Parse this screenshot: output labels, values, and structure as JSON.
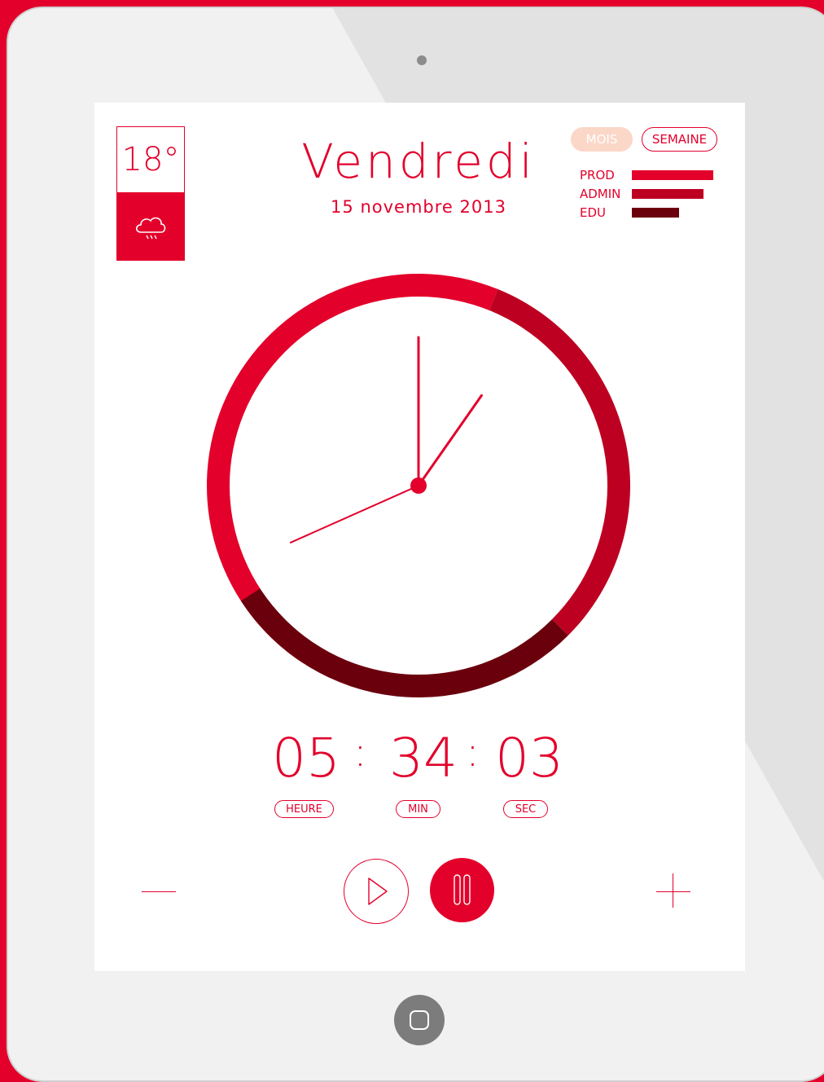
{
  "weather": {
    "temperature": "18°",
    "condition_icon": "rain-cloud-icon"
  },
  "header": {
    "day": "Vendredi",
    "date": "15 novembre 2013"
  },
  "view_toggle": {
    "month": "MOIS",
    "week": "SEMAINE",
    "active": "SEMAINE"
  },
  "legend": [
    {
      "label": "PROD",
      "value": 100,
      "color": "#e3002b"
    },
    {
      "label": "ADMIN",
      "value": 88,
      "color": "#bd0021"
    },
    {
      "label": "EDU",
      "value": 58,
      "color": "#6b000d"
    }
  ],
  "ring": {
    "segments": [
      {
        "name": "PROD",
        "from_deg": 213,
        "to_deg": 382,
        "color": "#e3002b"
      },
      {
        "name": "ADMIN",
        "from_deg": 22,
        "to_deg": 135,
        "color": "#bd0021"
      },
      {
        "name": "EDU",
        "from_deg": 135,
        "to_deg": 237,
        "color": "#6b000d"
      }
    ]
  },
  "clock_hands": {
    "hour": 1,
    "minute": 0,
    "second": 40
  },
  "timer": {
    "hours": "05",
    "minutes": "34",
    "seconds": "03",
    "separator": ":"
  },
  "timer_labels": {
    "hours": "HEURE",
    "minutes": "MIN",
    "seconds": "SEC"
  },
  "controls": {
    "minus": "minus-icon",
    "play": "play-icon",
    "pause": "pause-icon",
    "plus": "plus-icon"
  },
  "colors": {
    "accent": "#e3002b",
    "dark_red": "#bd0021",
    "maroon": "#6b000d",
    "month_pill": "#fbd7c8"
  }
}
